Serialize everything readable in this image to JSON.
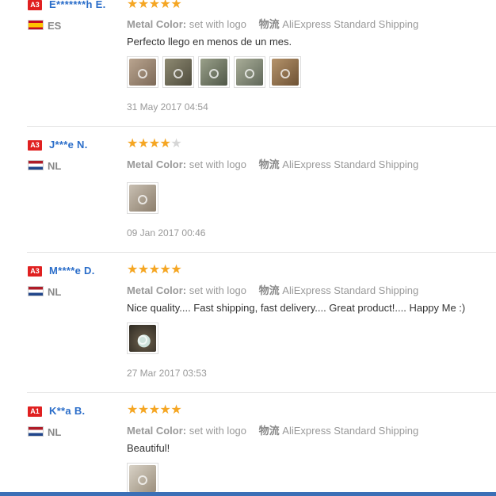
{
  "labels": {
    "metal_color": "Metal Color:",
    "shipping": "物流"
  },
  "reviews": [
    {
      "badge": "A3",
      "name": "E*******h E.",
      "country": "ES",
      "rating": 5,
      "metal_color": "set with logo",
      "shipping": "AliExpress Standard Shipping",
      "text": "Perfecto llego en menos de un mes.",
      "photos": 5,
      "date": "31 May 2017 04:54"
    },
    {
      "badge": "A3",
      "name": "J***e N.",
      "country": "NL",
      "rating": 4,
      "metal_color": "set with logo",
      "shipping": "AliExpress Standard Shipping",
      "text": "",
      "photos": 1,
      "date": "09 Jan 2017 00:46"
    },
    {
      "badge": "A3",
      "name": "M****e D.",
      "country": "NL",
      "rating": 5,
      "metal_color": "set with logo",
      "shipping": "AliExpress Standard Shipping",
      "text": "Nice quality.... Fast shipping, fast delivery.... Great product!.... Happy Me :)",
      "photos": 1,
      "date": "27 Mar 2017 03:53"
    },
    {
      "badge": "A1",
      "name": "K**a B.",
      "country": "NL",
      "rating": 5,
      "metal_color": "set with logo",
      "shipping": "AliExpress Standard Shipping",
      "text": "Beautiful!",
      "photos": 1,
      "date": ""
    }
  ],
  "colors": {
    "star": "#f5a623",
    "star_empty": "#d6d6d6",
    "name": "#2a6dc9",
    "badge": "#e02020"
  }
}
